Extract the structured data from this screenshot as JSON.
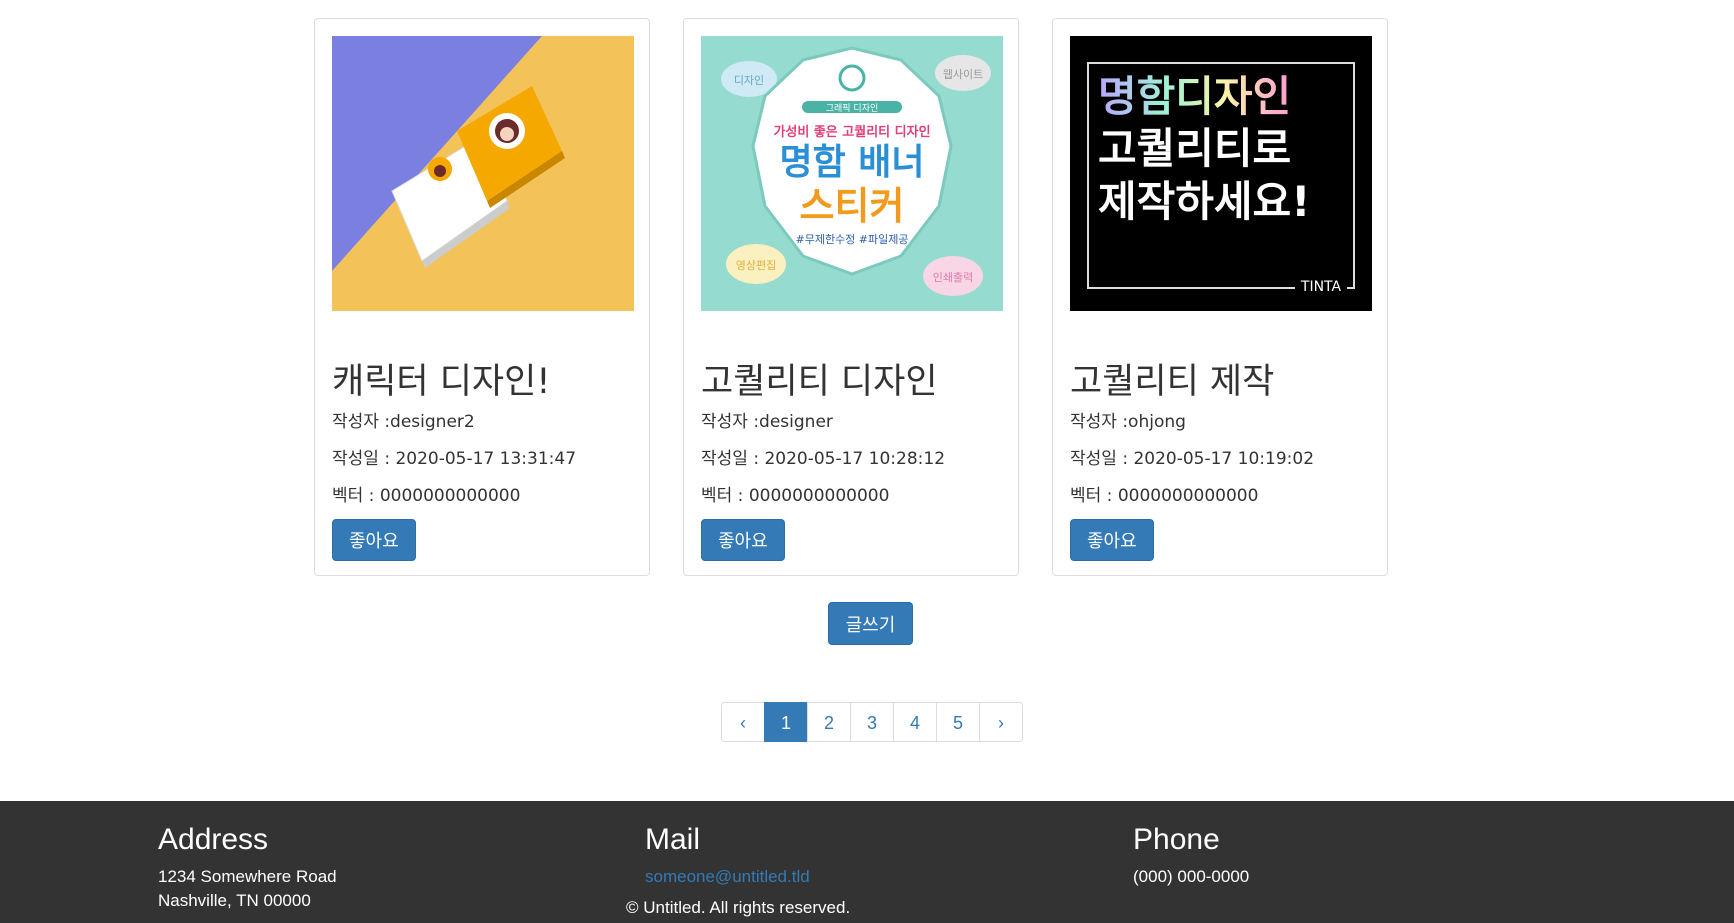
{
  "cards": [
    {
      "title": "캐릭터 디자인!",
      "author": "작성자 :designer2",
      "date": "작성일 : 2020-05-17 13:31:47",
      "vector": "벡터 : 0000000000000",
      "like_label": "좋아요"
    },
    {
      "title": "고퀄리티 디자인",
      "author": "작성자 :designer",
      "date": "작성일 : 2020-05-17 10:28:12",
      "vector": "벡터 : 0000000000000",
      "like_label": "좋아요",
      "image_text": {
        "brand": "그래픽 디자인",
        "line1": "가성비 좋은 고퀄리티 디자인",
        "line2": "명함 배너",
        "line3": "스티커",
        "tags": "#무제한수정 #파일제공",
        "cloud1": "디자인",
        "cloud2": "웹사이트",
        "cloud3": "영상편집",
        "cloud4": "인쇄출력"
      }
    },
    {
      "title": "고퀄리티 제작",
      "author": "작성자 :ohjong",
      "date": "작성일 : 2020-05-17 10:19:02",
      "vector": "벡터 : 0000000000000",
      "like_label": "좋아요",
      "image_text": {
        "line1": "명함디자인",
        "line2": "고퀄리티로",
        "line3": "제작하세요!",
        "sign": "TINTA"
      }
    }
  ],
  "write_label": "글쓰기",
  "pagination": {
    "prev": "‹",
    "pages": [
      "1",
      "2",
      "3",
      "4",
      "5"
    ],
    "next": "›",
    "current": "1"
  },
  "footer": {
    "address_heading": "Address",
    "address_line1": "1234 Somewhere Road",
    "address_line2": "Nashville, TN 00000",
    "mail_heading": "Mail",
    "mail_link": "someone@untitled.tld",
    "phone_heading": "Phone",
    "phone_number": "(000) 000-0000",
    "copyright": "© Untitled. All rights reserved."
  },
  "colors": {
    "primary": "#337ab7",
    "footer_bg": "#333333"
  }
}
